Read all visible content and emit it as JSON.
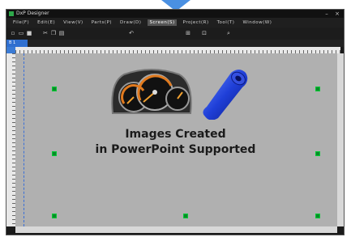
{
  "window": {
    "title": "DxP Designer",
    "minimize_glyph": "–",
    "close_glyph": "×"
  },
  "menu": {
    "items": [
      "File(F)",
      "Edit(E)",
      "View(V)",
      "Parts(P)",
      "Draw(D)",
      "Screen(S)",
      "Project(R)",
      "Tool(T)",
      "Window(W)"
    ],
    "active_index": 5
  },
  "toolbar": {
    "icons": [
      "new-icon",
      "open-icon",
      "save-icon",
      "cut-icon",
      "copy-icon",
      "paste-icon",
      "undo-icon",
      "align-icon",
      "group-icon",
      "zoom-icon"
    ]
  },
  "tab": {
    "label": "B 1"
  },
  "canvas": {
    "caption_line1": "Images Created",
    "caption_line2": "in PowerPoint Supported"
  },
  "colors": {
    "accent": "#4a90e2",
    "tab": "#2f6fd0",
    "canvas_bg": "#b0b0b0",
    "handle": "#0a8a2a"
  }
}
